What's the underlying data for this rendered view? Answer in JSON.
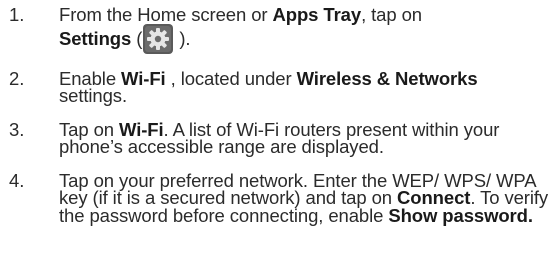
{
  "steps": [
    {
      "number": "1.",
      "parts": {
        "a": "From the Home screen or ",
        "b": "Apps Tray",
        "c": ", tap on ",
        "d": "Settings",
        "e": " (",
        "f": " )."
      },
      "icon": "settings-gear-icon"
    },
    {
      "number": "2.",
      "parts": {
        "a": "Enable ",
        "b": "Wi-Fi",
        "c": " , located under ",
        "d": "Wireless & Networks",
        "e": " settings."
      }
    },
    {
      "number": "3.",
      "parts": {
        "a": "Tap on ",
        "b": "Wi-Fi",
        "c": ". A list of Wi-Fi routers present within your phone’s accessible range are displayed."
      }
    },
    {
      "number": "4.",
      "parts": {
        "a": "Tap on your preferred network. Enter the WEP/ WPS/ WPA key (if it is a secured network) and tap on ",
        "b": "Connect",
        "c": ". To verify the password before connecting, enable ",
        "d": "Show password."
      }
    }
  ],
  "colors": {
    "text": "#2b2b2b",
    "icon_bg": "#5a5a5a",
    "icon_gear": "#e6e6e6"
  }
}
